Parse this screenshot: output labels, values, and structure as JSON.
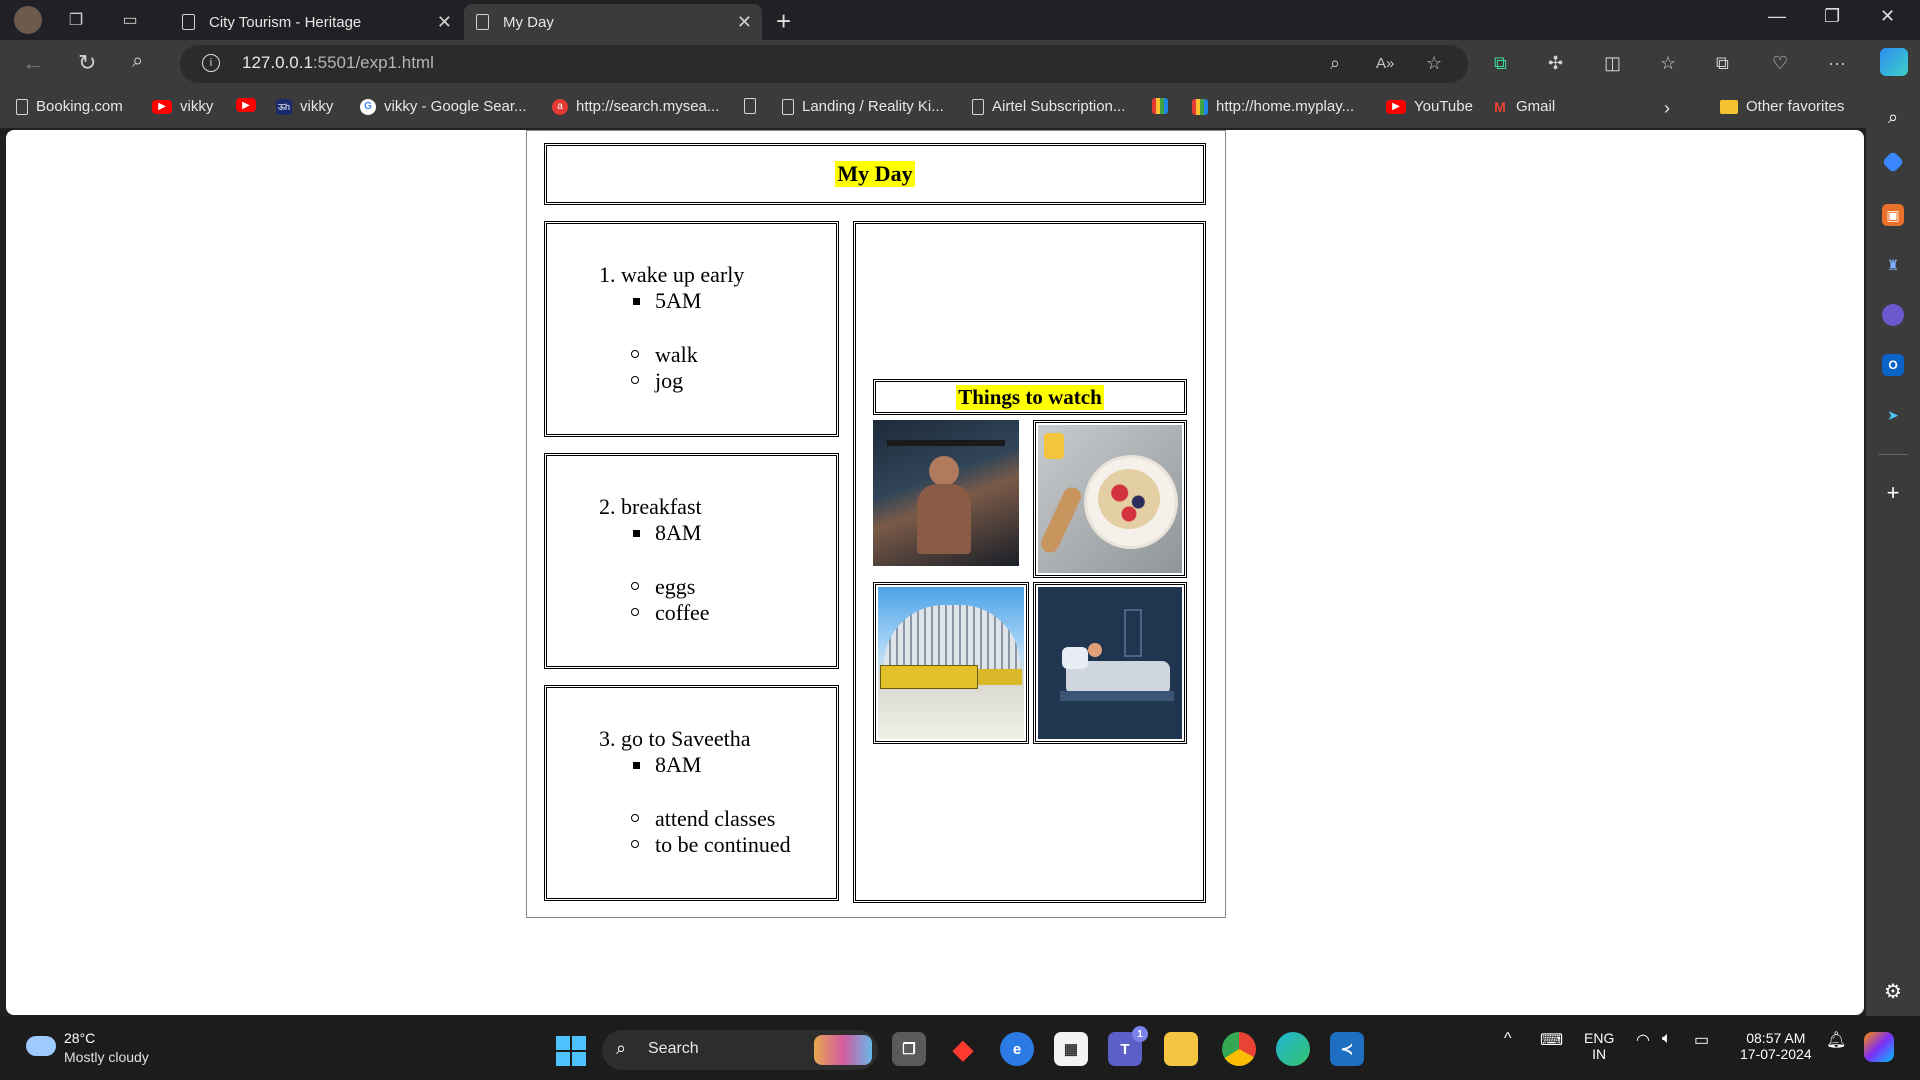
{
  "browser": {
    "tabs": [
      {
        "title": "City Tourism - Heritage",
        "active": false
      },
      {
        "title": "My Day",
        "active": true
      }
    ],
    "url_host": "127.0.0.1",
    "url_rest": ":5501/exp1.html",
    "favorites": [
      {
        "label": "Booking.com",
        "icon": "doc-icon"
      },
      {
        "label": "vikky",
        "icon": "youtube-icon"
      },
      {
        "label": "",
        "icon": "youtube-icon"
      },
      {
        "label": "vikky",
        "icon": "sh-icon"
      },
      {
        "label": "vikky - Google Sear...",
        "icon": "google-icon"
      },
      {
        "label": "http://search.mysea...",
        "icon": "ask-icon"
      },
      {
        "label": "",
        "icon": "doc-icon"
      },
      {
        "label": "Landing / Reality Ki...",
        "icon": "doc-icon"
      },
      {
        "label": "Airtel Subscription...",
        "icon": "doc-icon"
      },
      {
        "label": "",
        "icon": "bars-icon"
      },
      {
        "label": "http://home.myplay...",
        "icon": "bars-icon"
      },
      {
        "label": "YouTube",
        "icon": "youtube-icon"
      },
      {
        "label": "Gmail",
        "icon": "gmail-icon"
      }
    ],
    "other_favorites": "Other favorites"
  },
  "page": {
    "title": "My Day",
    "tasks": [
      {
        "number": "1.",
        "title": "wake up early",
        "time": "5AM",
        "items": [
          "walk",
          "jog"
        ]
      },
      {
        "number": "2.",
        "title": "breakfast",
        "time": "8AM",
        "items": [
          "eggs",
          "coffee"
        ]
      },
      {
        "number": "3.",
        "title": "go to Saveetha",
        "time": "8AM",
        "items": [
          "attend classes",
          "to be continued"
        ]
      }
    ],
    "watch_title": "Things to watch",
    "images": [
      {
        "name": "gym-workout-image"
      },
      {
        "name": "oatmeal-bowl-image"
      },
      {
        "name": "college-buses-image"
      },
      {
        "name": "sleeping-illustration-image"
      }
    ]
  },
  "taskbar": {
    "temperature": "28°C",
    "weather": "Mostly cloudy",
    "search_label": "Search",
    "language": "ENG",
    "region": "IN",
    "time": "08:57 AM",
    "date": "17-07-2024",
    "teams_badge": "1"
  },
  "colors": {
    "highlight": "#ffff00",
    "chrome_dark": "#202124",
    "chrome": "#3b3b3b",
    "taskbar": "#1c1c1c",
    "windows_blue": "#4cc2ff"
  }
}
